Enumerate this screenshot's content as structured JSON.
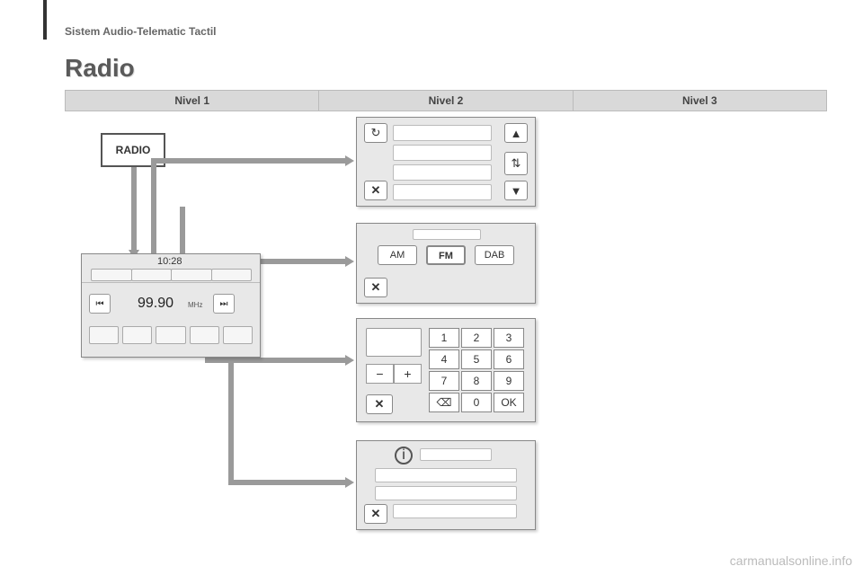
{
  "header": {
    "section": "Sistem Audio-Telematic Tactil",
    "title": "Radio"
  },
  "levels": {
    "l1": "Nivel 1",
    "l2": "Nivel 2",
    "l3": "Nivel 3"
  },
  "radio_button_label": "RADIO",
  "main_screen": {
    "time": "10:28",
    "frequency": "99.90",
    "unit": "MHz",
    "prev_icon": "⏮",
    "next_icon": "⏭"
  },
  "panel_list": {
    "refresh_icon": "↻",
    "shuffle_icon": "⇅",
    "up_icon": "▲",
    "down_icon": "▼",
    "close_icon": "✕"
  },
  "panel_band": {
    "close_icon": "✕",
    "bands": {
      "am": "AM",
      "fm": "FM",
      "dab": "DAB"
    }
  },
  "panel_keypad": {
    "minus": "−",
    "plus": "+",
    "close_icon": "✕",
    "backspace_icon": "⌫",
    "ok": "OK",
    "keys": [
      "1",
      "2",
      "3",
      "4",
      "5",
      "6",
      "7",
      "8",
      "9"
    ],
    "zero": "0"
  },
  "panel_info": {
    "info_icon": "i",
    "close_icon": "✕"
  },
  "watermark": "carmanualsonline.info"
}
